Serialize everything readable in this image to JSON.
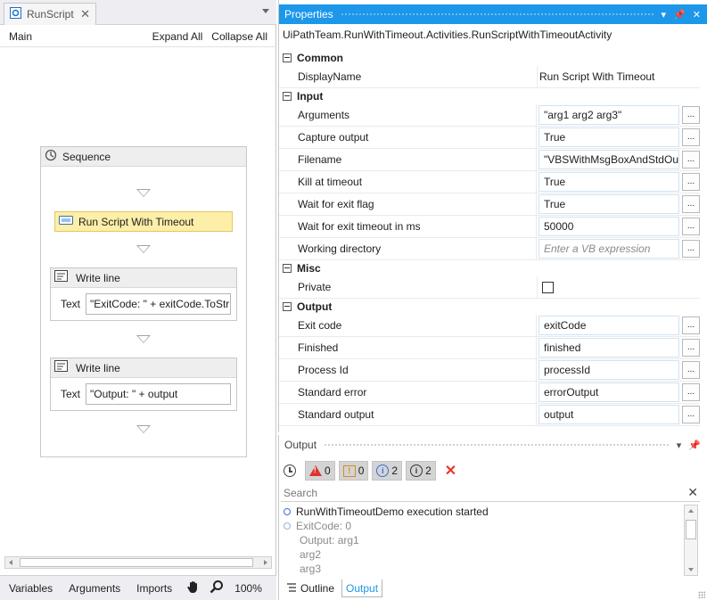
{
  "designer": {
    "tab_label": "RunScript",
    "breadcrumb": "Main",
    "expand_all": "Expand All",
    "collapse_all": "Collapse All",
    "sequence_title": "Sequence",
    "activities": [
      {
        "title": "Run Script With Timeout"
      },
      {
        "title": "Write line",
        "text_label": "Text",
        "text_value": "\"ExitCode: \" + exitCode.ToStr"
      },
      {
        "title": "Write line",
        "text_label": "Text",
        "text_value": "\"Output: \" + output"
      }
    ],
    "bottom_tabs": [
      "Variables",
      "Arguments",
      "Imports"
    ],
    "zoom": "100%"
  },
  "properties": {
    "title": "Properties",
    "type_name": "UiPathTeam.RunWithTimeout.Activities.RunScriptWithTimeoutActivity",
    "categories": [
      {
        "name": "Common",
        "rows": [
          {
            "name": "DisplayName",
            "value": "Run Script With Timeout"
          }
        ]
      },
      {
        "name": "Input",
        "rows": [
          {
            "name": "Arguments",
            "value": "\"arg1 arg2  arg3\""
          },
          {
            "name": "Capture output",
            "value": "True"
          },
          {
            "name": "Filename",
            "value": "\"VBSWithMsgBoxAndStdOut"
          },
          {
            "name": "Kill at timeout",
            "value": "True"
          },
          {
            "name": "Wait for exit flag",
            "value": "True"
          },
          {
            "name": "Wait for exit timeout in ms",
            "value": "50000"
          },
          {
            "name": "Working directory",
            "placeholder": "Enter a VB expression"
          }
        ]
      },
      {
        "name": "Misc",
        "rows": [
          {
            "name": "Private",
            "checked": false
          }
        ]
      },
      {
        "name": "Output",
        "rows": [
          {
            "name": "Exit code",
            "value": "exitCode"
          },
          {
            "name": "Finished",
            "value": "finished"
          },
          {
            "name": "Process Id",
            "value": "processId"
          },
          {
            "name": "Standard error",
            "value": "errorOutput"
          },
          {
            "name": "Standard output",
            "value": "output"
          }
        ]
      }
    ],
    "ellipsis": "..."
  },
  "output": {
    "title": "Output",
    "counts": {
      "errors": "0",
      "warnings": "0",
      "info": "2",
      "trace": "2"
    },
    "search_placeholder": "Search",
    "log": [
      {
        "text": "RunWithTimeoutDemo execution started",
        "dim": false
      },
      {
        "text": "ExitCode: 0",
        "dim": true
      },
      {
        "text": "Output: arg1",
        "sub": true
      },
      {
        "text": "arg2",
        "sub": true
      },
      {
        "text": "arg3",
        "sub": true
      }
    ],
    "tabs": [
      "Outline",
      "Output"
    ]
  },
  "colors": {
    "accent": "#1c97ea",
    "activity_highlight": "#fdeea8",
    "error": "#e23a2a"
  }
}
